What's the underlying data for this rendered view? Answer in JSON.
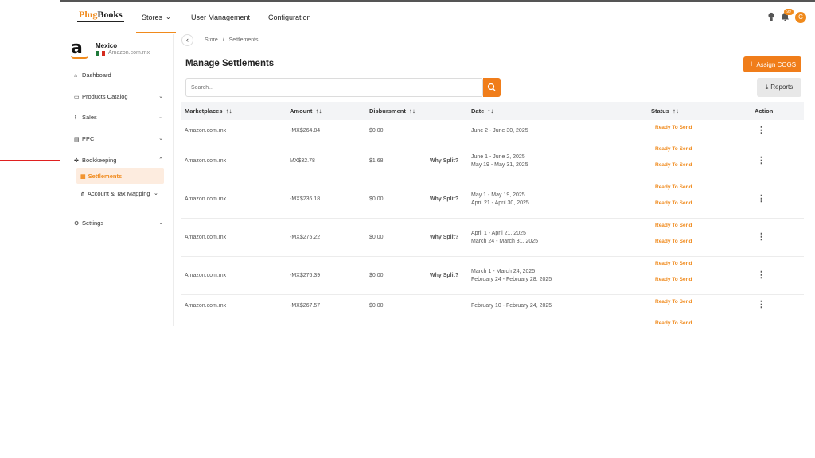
{
  "brand": {
    "part1": "Plug",
    "part2": "Books"
  },
  "topnav": {
    "stores": "Stores",
    "users": "User Management",
    "config": "Configuration",
    "badge": "99",
    "avatar": "C"
  },
  "store": {
    "logo": "a",
    "name": "Mexico",
    "domain": "Amazon.com.mx"
  },
  "sidebar": {
    "items": [
      {
        "label": "Dashboard"
      },
      {
        "label": "Products Catalog"
      },
      {
        "label": "Sales"
      },
      {
        "label": "PPC"
      },
      {
        "label": "Bookkeeping"
      },
      {
        "label": "Settings"
      }
    ],
    "sub_active": "Settlements",
    "sub_item": "Account & Tax Mapping"
  },
  "breadcrumb": {
    "store": "Store",
    "sep": "/",
    "current": "Settlements"
  },
  "page": {
    "title": "Manage Settlements",
    "assign": "Assign COGS",
    "reports": "Reports"
  },
  "search": {
    "placeholder": "Search..."
  },
  "table": {
    "headers": [
      "Marketplaces",
      "Amount",
      "Disbursment",
      "Date",
      "Status",
      "Action"
    ],
    "rows": [
      {
        "marketplace": "Amazon.com.mx",
        "amount": "-MX$264.84",
        "disbursement": "$0.00",
        "split": "",
        "date1": "June 2 - June 30, 2025",
        "date2": "",
        "status1": "Ready To Send",
        "status2": ""
      },
      {
        "marketplace": "Amazon.com.mx",
        "amount": "MX$32.78",
        "disbursement": "$1.68",
        "split": "Why Split?",
        "date1": "June 1 - June 2, 2025",
        "date2": "May 19 - May 31, 2025",
        "status1": "Ready To Send",
        "status2": "Ready To Send"
      },
      {
        "marketplace": "Amazon.com.mx",
        "amount": "-MX$236.18",
        "disbursement": "$0.00",
        "split": "Why Split?",
        "date1": "May 1 - May 19, 2025",
        "date2": "April 21 - April 30, 2025",
        "status1": "Ready To Send",
        "status2": "Ready To Send"
      },
      {
        "marketplace": "Amazon.com.mx",
        "amount": "-MX$275.22",
        "disbursement": "$0.00",
        "split": "Why Split?",
        "date1": "April 1 - April 21, 2025",
        "date2": "March 24 - March 31, 2025",
        "status1": "Ready To Send",
        "status2": "Ready To Send"
      },
      {
        "marketplace": "Amazon.com.mx",
        "amount": "-MX$276.39",
        "disbursement": "$0.00",
        "split": "Why Split?",
        "date1": "March 1 - March 24, 2025",
        "date2": "February 24 - February 28, 2025",
        "status1": "Ready To Send",
        "status2": "Ready To Send"
      },
      {
        "marketplace": "Amazon.com.mx",
        "amount": "-MX$267.57",
        "disbursement": "$0.00",
        "split": "",
        "date1": "February 10 - February 24, 2025",
        "date2": "",
        "status1": "Ready To Send",
        "status2": ""
      },
      {
        "status1": "Ready To Send"
      }
    ]
  },
  "colors": {
    "accent": "#f08a1c",
    "annotation_arrow": "#e02020"
  }
}
